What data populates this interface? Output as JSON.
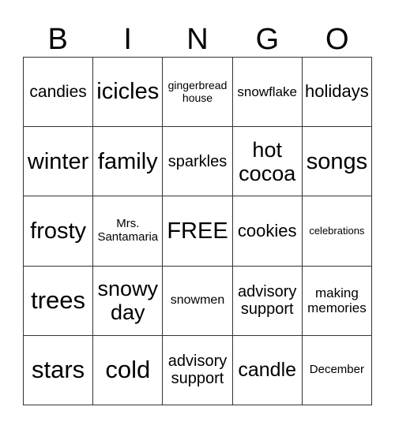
{
  "header": [
    "B",
    "I",
    "N",
    "G",
    "O"
  ],
  "cells": [
    [
      "candies",
      "icicles",
      "gingerbread house",
      "snowflake",
      "holidays"
    ],
    [
      "winter",
      "family",
      "sparkles",
      "hot cocoa",
      "songs"
    ],
    [
      "frosty",
      "Mrs. Santamaria",
      "FREE",
      "cookies",
      "celebrations"
    ],
    [
      "trees",
      "snowy day",
      "snowmen",
      "advisory support",
      "making memories"
    ],
    [
      "stars",
      "cold",
      "advisory support",
      "candle",
      "December"
    ]
  ]
}
